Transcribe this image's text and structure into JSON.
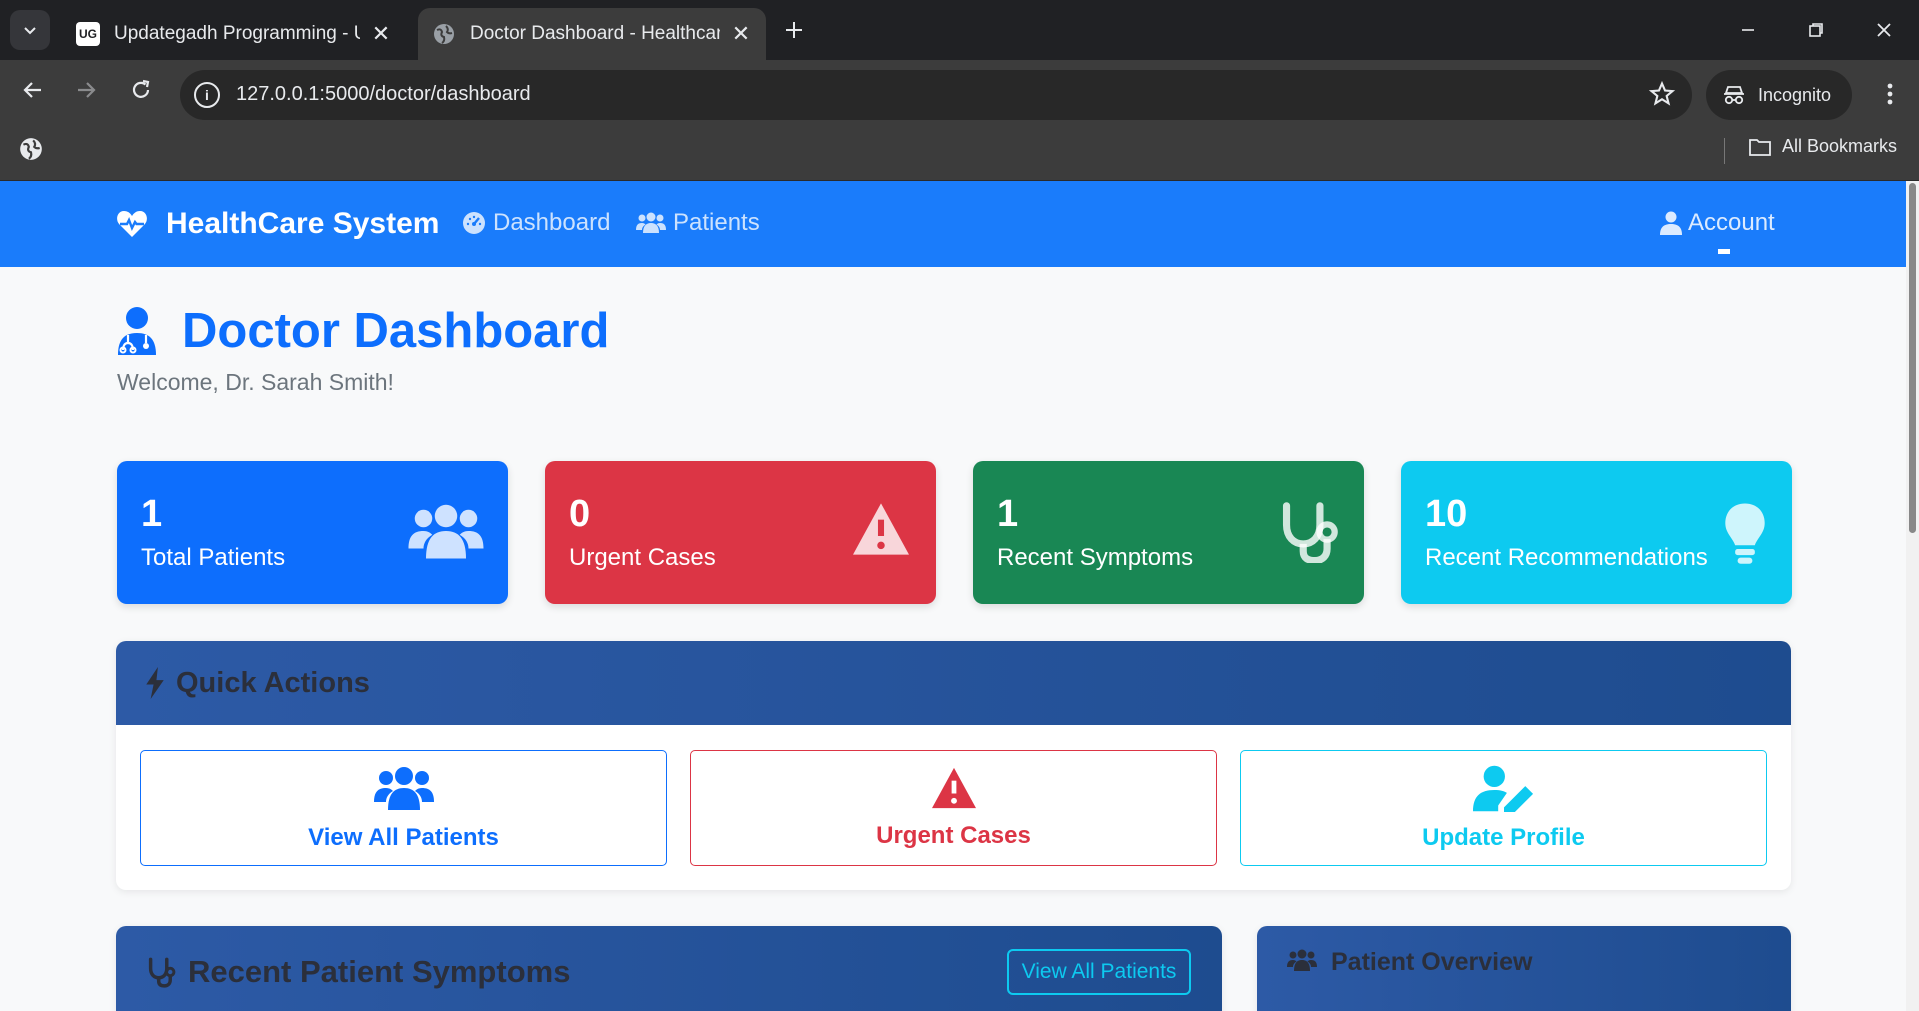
{
  "browser": {
    "tabs": [
      {
        "title": "Updategadh Programming - Up",
        "favicon": "UG",
        "active": false
      },
      {
        "title": "Doctor Dashboard - Healthcare",
        "favicon": "globe-icon",
        "active": true
      }
    ],
    "url": "127.0.0.1:5000/doctor/dashboard",
    "incognito_label": "Incognito",
    "bookmarks_label": "All Bookmarks"
  },
  "app_nav": {
    "brand": "HealthCare System",
    "links": [
      {
        "label": "Dashboard",
        "icon": "tachometer-icon"
      },
      {
        "label": "Patients",
        "icon": "users-icon"
      }
    ],
    "account_label": "Account",
    "color": "#1a7cfb"
  },
  "header": {
    "title": "Doctor Dashboard",
    "welcome": "Welcome, Dr. Sarah Smith!"
  },
  "stats": [
    {
      "value": "1",
      "label": "Total Patients",
      "color": "#0d6efd",
      "icon": "users-icon"
    },
    {
      "value": "0",
      "label": "Urgent Cases",
      "color": "#dc3545",
      "icon": "warning-icon"
    },
    {
      "value": "1",
      "label": "Recent Symptoms",
      "color": "#198754",
      "icon": "stethoscope-icon"
    },
    {
      "value": "10",
      "label": "Recent Recommendations",
      "color": "#0dcaf0",
      "icon": "lightbulb-icon"
    }
  ],
  "quick_actions": {
    "title": "Quick Actions",
    "buttons": [
      {
        "label": "View All Patients",
        "color": "#0d6efd",
        "icon": "users-icon"
      },
      {
        "label": "Urgent Cases",
        "color": "#dc3545",
        "icon": "warning-icon"
      },
      {
        "label": "Update Profile",
        "color": "#0dcaf0",
        "icon": "user-edit-icon"
      }
    ]
  },
  "recent_symptoms": {
    "title": "Recent Patient Symptoms",
    "button": "View All Patients"
  },
  "patient_overview": {
    "title": "Patient Overview"
  }
}
